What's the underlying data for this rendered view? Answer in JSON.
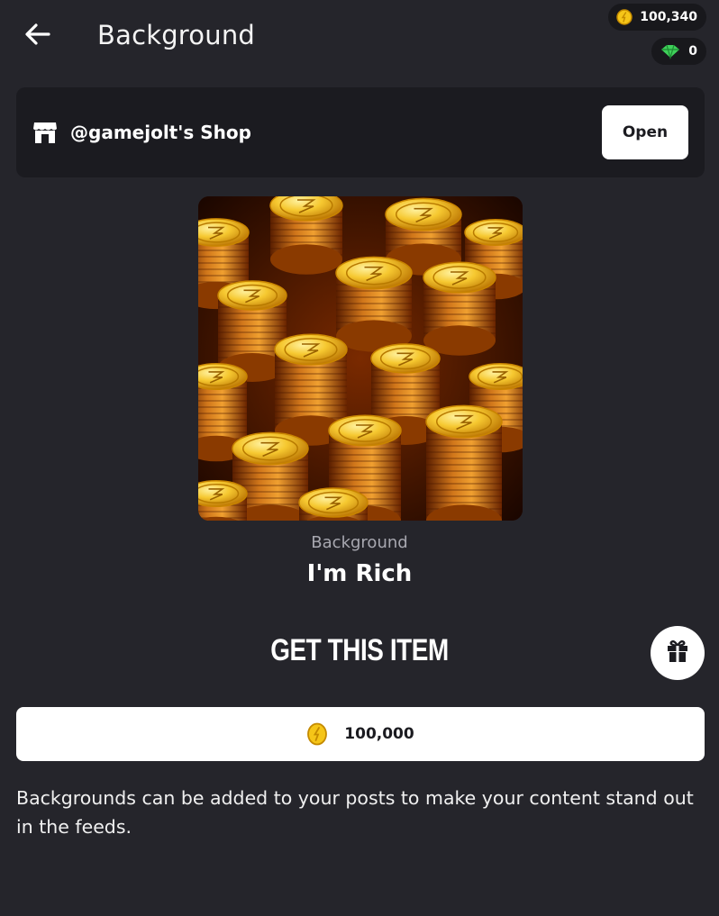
{
  "header": {
    "title": "Background",
    "back_icon": "arrow-left-icon"
  },
  "wallet": {
    "coins": "100,340",
    "coins_icon": "coin-icon",
    "gems": "0",
    "gems_icon": "gem-icon"
  },
  "shop": {
    "icon": "store-icon",
    "name": "@gamejolt's Shop",
    "open_label": "Open"
  },
  "item": {
    "type": "Background",
    "name": "I'm Rich"
  },
  "purchase": {
    "title": "GET THIS ITEM",
    "gift_icon": "gift-icon",
    "price": "100,000",
    "price_icon": "coin-icon"
  },
  "description": "Backgrounds can be added to your posts to make your content stand out in the feeds.",
  "colors": {
    "background": "#25252b",
    "panel": "#1b1b20",
    "coin_gold": "#f5c518",
    "gem_green": "#3fd15a"
  }
}
